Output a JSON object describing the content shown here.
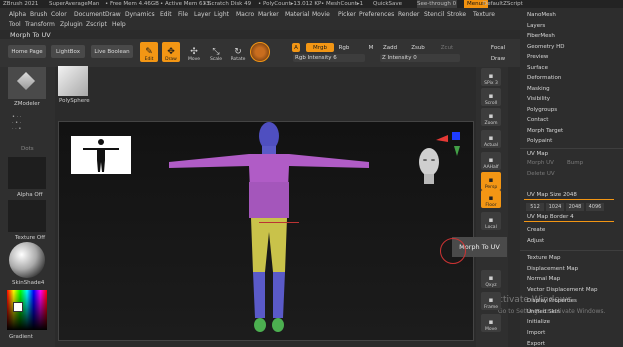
{
  "titlebar": {
    "app": "ZBrush 2021",
    "document": "SuperAverageMan",
    "free_mem": "• Free Mem 4.46GB",
    "active_mem": "• Active Mem 633",
    "scratch": "• Scratch Disk 49",
    "polycount": "• PolyCount▸13.012 KP",
    "meshcount": "• MeshCount▸1",
    "quicksave": "QuickSave",
    "seethrough": "See-through  0",
    "menus": "Menus",
    "script": "DefaultZScript"
  },
  "menubar": {
    "row1": [
      "Alpha",
      "Brush",
      "Color",
      "Document",
      "Draw",
      "Dynamics",
      "Edit",
      "File",
      "Layer",
      "Light",
      "Macro",
      "Marker",
      "Material",
      "Movie",
      "Picker",
      "Preferences",
      "Render",
      "Stencil",
      "Stroke",
      "Texture"
    ],
    "row2": [
      "Tool",
      "Transform",
      "Zplugin",
      "Zscript",
      "Help"
    ]
  },
  "subtitle": "Morph To UV",
  "toolbar": {
    "home": "Home Page",
    "lightbox": "LightBox",
    "liveboolean": "Live Boolean",
    "edit": "Edit",
    "draw": "Draw",
    "move": "Move",
    "scale": "Scale",
    "rotate": "Rotate",
    "a": "A",
    "mrgb": "Mrgb",
    "rgb": "Rgb",
    "m": "M",
    "zadd": "Zadd",
    "zsub": "Zsub",
    "zcut": "Zcut",
    "rgb_intensity": "Rgb Intensity 6",
    "z_intensity": "Z Intensity 0",
    "focal": "Focal",
    "draw_size": "Draw"
  },
  "leftshelf": {
    "tool1": "ZModeler",
    "tool2": "PolySphere",
    "dots": "Dots",
    "alpha": "Alpha Off",
    "texture": "Texture Off",
    "material": "SkinShade4",
    "gradient": "Gradient"
  },
  "rightshelf": [
    "SPix 3",
    "Scroll",
    "Zoom",
    "Actual",
    "AAHalf",
    "Persp",
    "Floor",
    "Local",
    "Qxyz",
    "Frame",
    "Move"
  ],
  "tooltip": "Morph To UV",
  "palette": {
    "top": [
      "NanoMesh",
      "Layers",
      "FiberMesh",
      "Geometry HD",
      "Preview",
      "Surface",
      "Deformation",
      "Masking",
      "Visibility",
      "Polygroups",
      "Contact",
      "Morph Target",
      "Polypaint"
    ],
    "uvmap": "UV Map",
    "morph_uv": "Morph UV",
    "delete_uv": "Delete UV",
    "bump": "Bump",
    "uv_map_size_label": "UV Map Size",
    "uv_map_size": "2048",
    "sizes": [
      "512",
      "1024",
      "2048",
      "4096"
    ],
    "uv_border": "UV Map Border 4",
    "create": "Create",
    "adjust": "Adjust",
    "bottom": [
      "Texture Map",
      "Displacement Map",
      "Normal Map",
      "Vector Displacement Map",
      "Display Properties",
      "Unified Skin",
      "Initialize",
      "Import",
      "Export"
    ]
  },
  "watermark": {
    "line1": "Activate Windows",
    "line2": "Go to Settings to activate Windows."
  },
  "colors": {
    "accent": "#f39614",
    "body_top": "#b05cc6",
    "head": "#4f4fc0",
    "legs": "#c9c24a",
    "feet": "#4caf50"
  }
}
